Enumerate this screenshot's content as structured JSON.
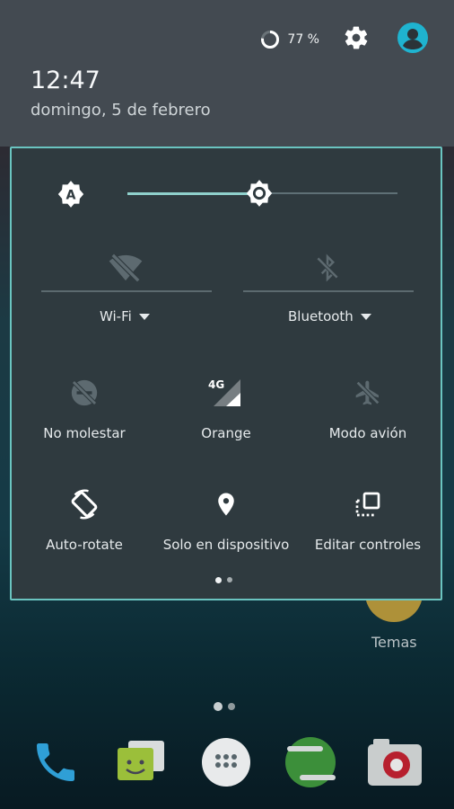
{
  "status": {
    "battery_percent": 77,
    "battery_label": "77 %"
  },
  "header": {
    "time": "12:47",
    "date": "domingo, 5 de febrero"
  },
  "brightness": {
    "level": 0.49,
    "auto": true
  },
  "big_tiles": [
    {
      "label": "Wi-Fi",
      "icon": "wifi-off-icon"
    },
    {
      "label": "Bluetooth",
      "icon": "bluetooth-off-icon"
    }
  ],
  "tiles": [
    {
      "label": "No molestar",
      "icon": "do-not-disturb-icon"
    },
    {
      "label": "Orange",
      "icon": "cellular-4g-icon",
      "badge": "4G"
    },
    {
      "label": "Modo avión",
      "icon": "airplane-mode-icon"
    },
    {
      "label": "Auto-rotate",
      "icon": "auto-rotate-icon"
    },
    {
      "label": "Solo en dispositivo",
      "icon": "location-icon"
    },
    {
      "label": "Editar controles",
      "icon": "edit-controls-icon"
    }
  ],
  "pager": {
    "pages": 2,
    "current": 1
  },
  "home": {
    "shortcut_label": "Temas",
    "dock": [
      "phone-icon",
      "messenger-icon",
      "app-drawer-icon",
      "hangouts-icon",
      "camera-icon"
    ]
  },
  "colors": {
    "accent": "#8fd0cc",
    "panel": "#2f3a3f",
    "header": "#434a51"
  }
}
